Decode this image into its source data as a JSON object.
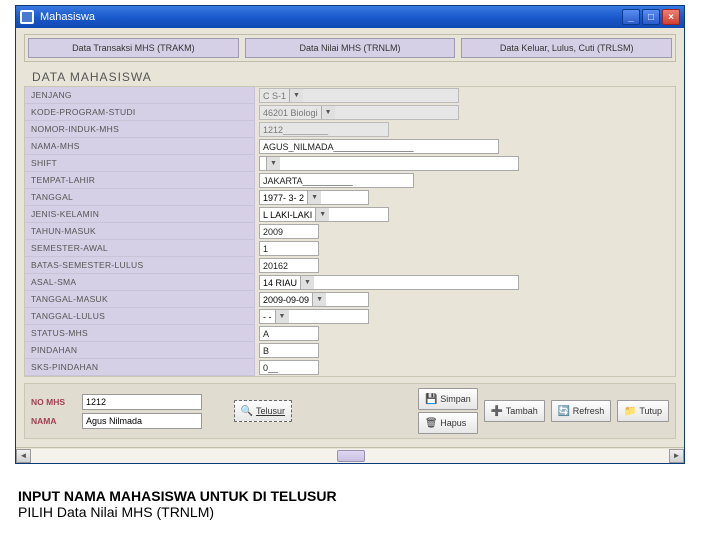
{
  "window": {
    "title": "Mahasiswa"
  },
  "tabs": [
    {
      "label": "Data Transaksi MHS (TRAKM)"
    },
    {
      "label": "Data Nilai MHS (TRNLM)"
    },
    {
      "label": "Data Keluar, Lulus, Cuti (TRLSM)"
    }
  ],
  "section_title": "DATA MAHASISWA",
  "fields": {
    "jenjang": {
      "label": "JENJANG",
      "value": "C S-1"
    },
    "kode_program_studi": {
      "label": "KODE-PROGRAM-STUDI",
      "value": "46201 Biologi"
    },
    "nomor_induk_mhs": {
      "label": "NOMOR-INDUK-MHS",
      "value": "1212_________"
    },
    "nama_mhs": {
      "label": "NAMA-MHS",
      "value": "AGUS_NILMADA________________"
    },
    "shift": {
      "label": "SHIFT",
      "value": ""
    },
    "tempat_lahir": {
      "label": "TEMPAT-LAHIR",
      "value": "JAKARTA__________"
    },
    "tanggal": {
      "label": "TANGGAL",
      "value": "1977- 3- 2"
    },
    "jenis_kelamin": {
      "label": "JENIS-KELAMIN",
      "value": "L LAKI-LAKI"
    },
    "tahun_masuk": {
      "label": "TAHUN-MASUK",
      "value": "2009"
    },
    "semester_awal": {
      "label": "SEMESTER-AWAL",
      "value": "1"
    },
    "batas_semester_lulus": {
      "label": "BATAS-SEMESTER-LULUS",
      "value": "20162"
    },
    "asal_sma": {
      "label": "ASAL-SMA",
      "value": "14 RIAU"
    },
    "tanggal_masuk": {
      "label": "TANGGAL-MASUK",
      "value": "2009-09-09"
    },
    "tanggal_lulus": {
      "label": "TANGGAL-LULUS",
      "value": "  -  -"
    },
    "status_mhs": {
      "label": "STATUS-MHS",
      "value": "A"
    },
    "pindahan": {
      "label": "PINDAHAN",
      "value": "B"
    },
    "sks_pindahan": {
      "label": "SKS-PINDAHAN",
      "value": "0__"
    }
  },
  "bottom": {
    "no_mhs_label": "NO MHS",
    "no_mhs_value": "1212",
    "nama_label": "NAMA",
    "nama_value": "Agus Nilmada"
  },
  "buttons": {
    "telusur": "Telusur",
    "simpan": "Simpan",
    "hapus": "Hapus",
    "tambah": "Tambah",
    "refresh": "Refresh",
    "tutup": "Tutup"
  },
  "caption": {
    "line1": "INPUT NAMA MAHASISWA UNTUK DI TELUSUR",
    "line2": "PILIH Data Nilai MHS (TRNLM)"
  }
}
